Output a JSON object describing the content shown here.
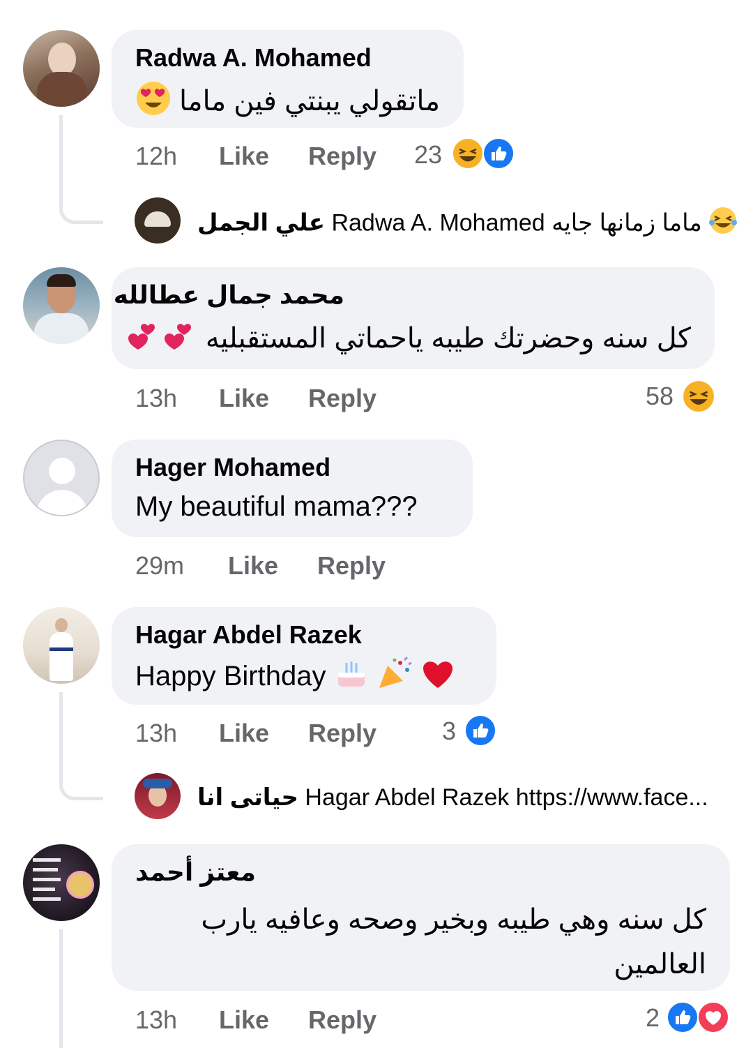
{
  "comments": [
    {
      "author": "Radwa A. Mohamed",
      "text": "ماتقولي يبنتي فين ماما",
      "time": "12h",
      "like": "Like",
      "reply": "Reply",
      "reaction_count": "23",
      "reactions": [
        "haha-icon",
        "like-icon"
      ],
      "reply_preview": {
        "author": "علي الجمل",
        "text": "Radwa A. Mohamed ماما زمانها جايه"
      }
    },
    {
      "author": "محمد جمال عطالله",
      "text": "كل سنه وحضرتك طيبه ياحماتي المستقبليه",
      "time": "13h",
      "like": "Like",
      "reply": "Reply",
      "reaction_count": "58",
      "reactions": [
        "haha-icon"
      ]
    },
    {
      "author": "Hager Mohamed",
      "text": "My beautiful mama???",
      "time": "29m",
      "like": "Like",
      "reply": "Reply"
    },
    {
      "author": "Hagar Abdel Razek",
      "text": "Happy Birthday",
      "time": "13h",
      "like": "Like",
      "reply": "Reply",
      "reaction_count": "3",
      "reactions": [
        "like-icon"
      ],
      "reply_preview": {
        "author": "حياتى انا",
        "text": "Hagar Abdel Razek https://www.face..."
      }
    },
    {
      "author": "معتز أحمد",
      "text_line1": "كل سنه وهي طيبه وبخير وصحه وعافيه يارب",
      "text_line2": "العالمين",
      "time": "13h",
      "like": "Like",
      "reply": "Reply",
      "reaction_count": "2",
      "reactions": [
        "like-icon",
        "love-icon"
      ]
    }
  ],
  "colors": {
    "bubble": "#f0f2f5",
    "meta_text": "#65676b",
    "like_blue": "#1877f2",
    "love_red": "#f33e58",
    "haha_yellow": "#f7b125",
    "thread_line": "#e4e6eb"
  }
}
